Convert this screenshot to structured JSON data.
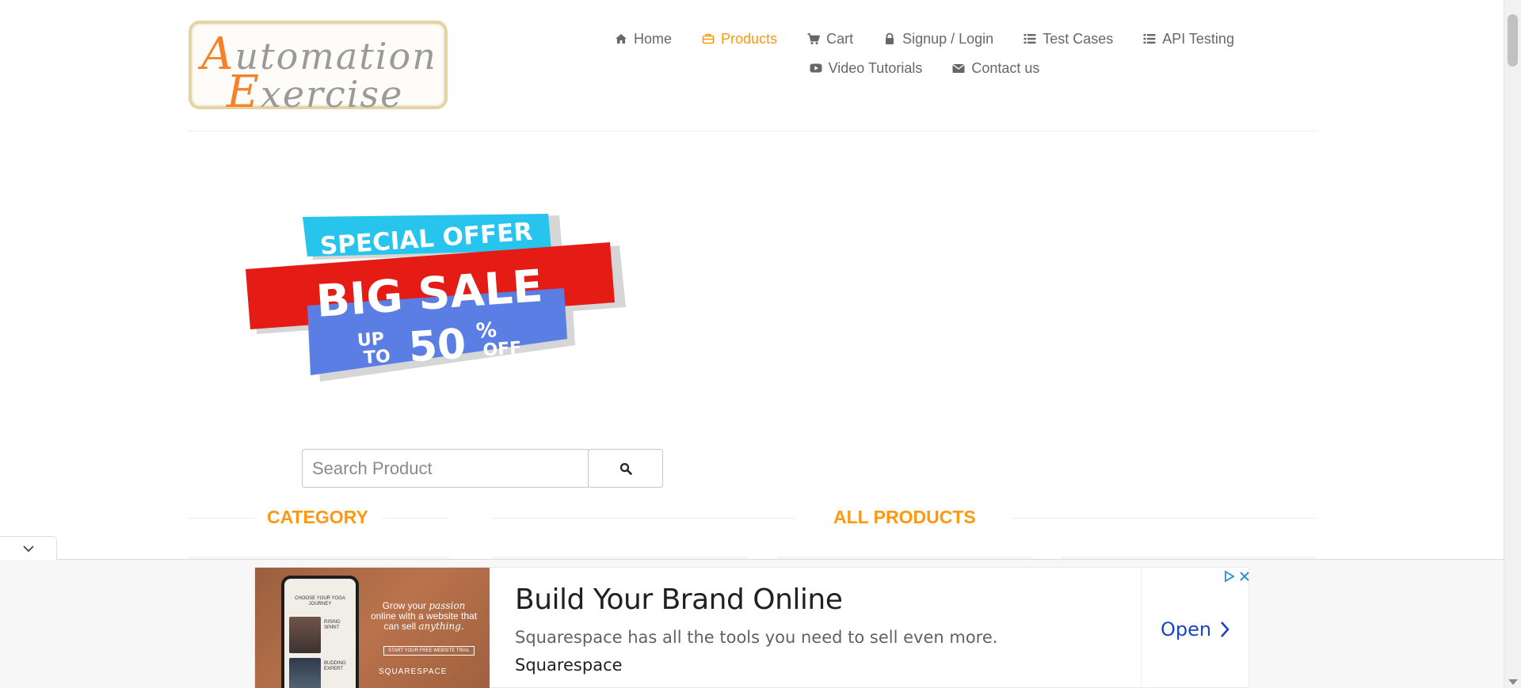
{
  "brand": {
    "logo_line1_cap": "A",
    "logo_line1_rest": "utomation",
    "logo_line2_cap": "E",
    "logo_line2_rest": "xercise"
  },
  "nav": {
    "home": "Home",
    "products": "Products",
    "cart": "Cart",
    "signup": "Signup / Login",
    "test_cases": "Test Cases",
    "api_testing": "API Testing",
    "video_tutorials": "Video Tutorials",
    "contact": "Contact us"
  },
  "banner": {
    "line1": "SPECIAL OFFER",
    "line2": "BIG SALE",
    "up": "UP",
    "to": "TO",
    "percent_value": "50",
    "percent_sign": "%",
    "off": "OFF"
  },
  "search": {
    "placeholder": "Search Product"
  },
  "sections": {
    "category": "CATEGORY",
    "all_products": "ALL PRODUCTS"
  },
  "ad": {
    "headline": "Build Your Brand Online",
    "description": "Squarespace has all the tools you need to sell even more.",
    "advertiser": "Squarespace",
    "cta": "Open",
    "image_copy_1": "Grow your",
    "image_copy_italic_1": "passion",
    "image_copy_2": "online with a website that can sell",
    "image_copy_italic_2": "anything.",
    "image_button": "START YOUR FREE WEBSITE TRIAL",
    "image_brand": "SQUARESPACE",
    "phone_heading": "CHOOSE YOUR YOGA JOURNEY",
    "phone_item1": "RISING SPIRIT",
    "phone_item2": "BUDDING EXPERT"
  },
  "colors": {
    "accent": "#fe980f",
    "text": "#696763",
    "ad_link": "#1a44c8"
  }
}
